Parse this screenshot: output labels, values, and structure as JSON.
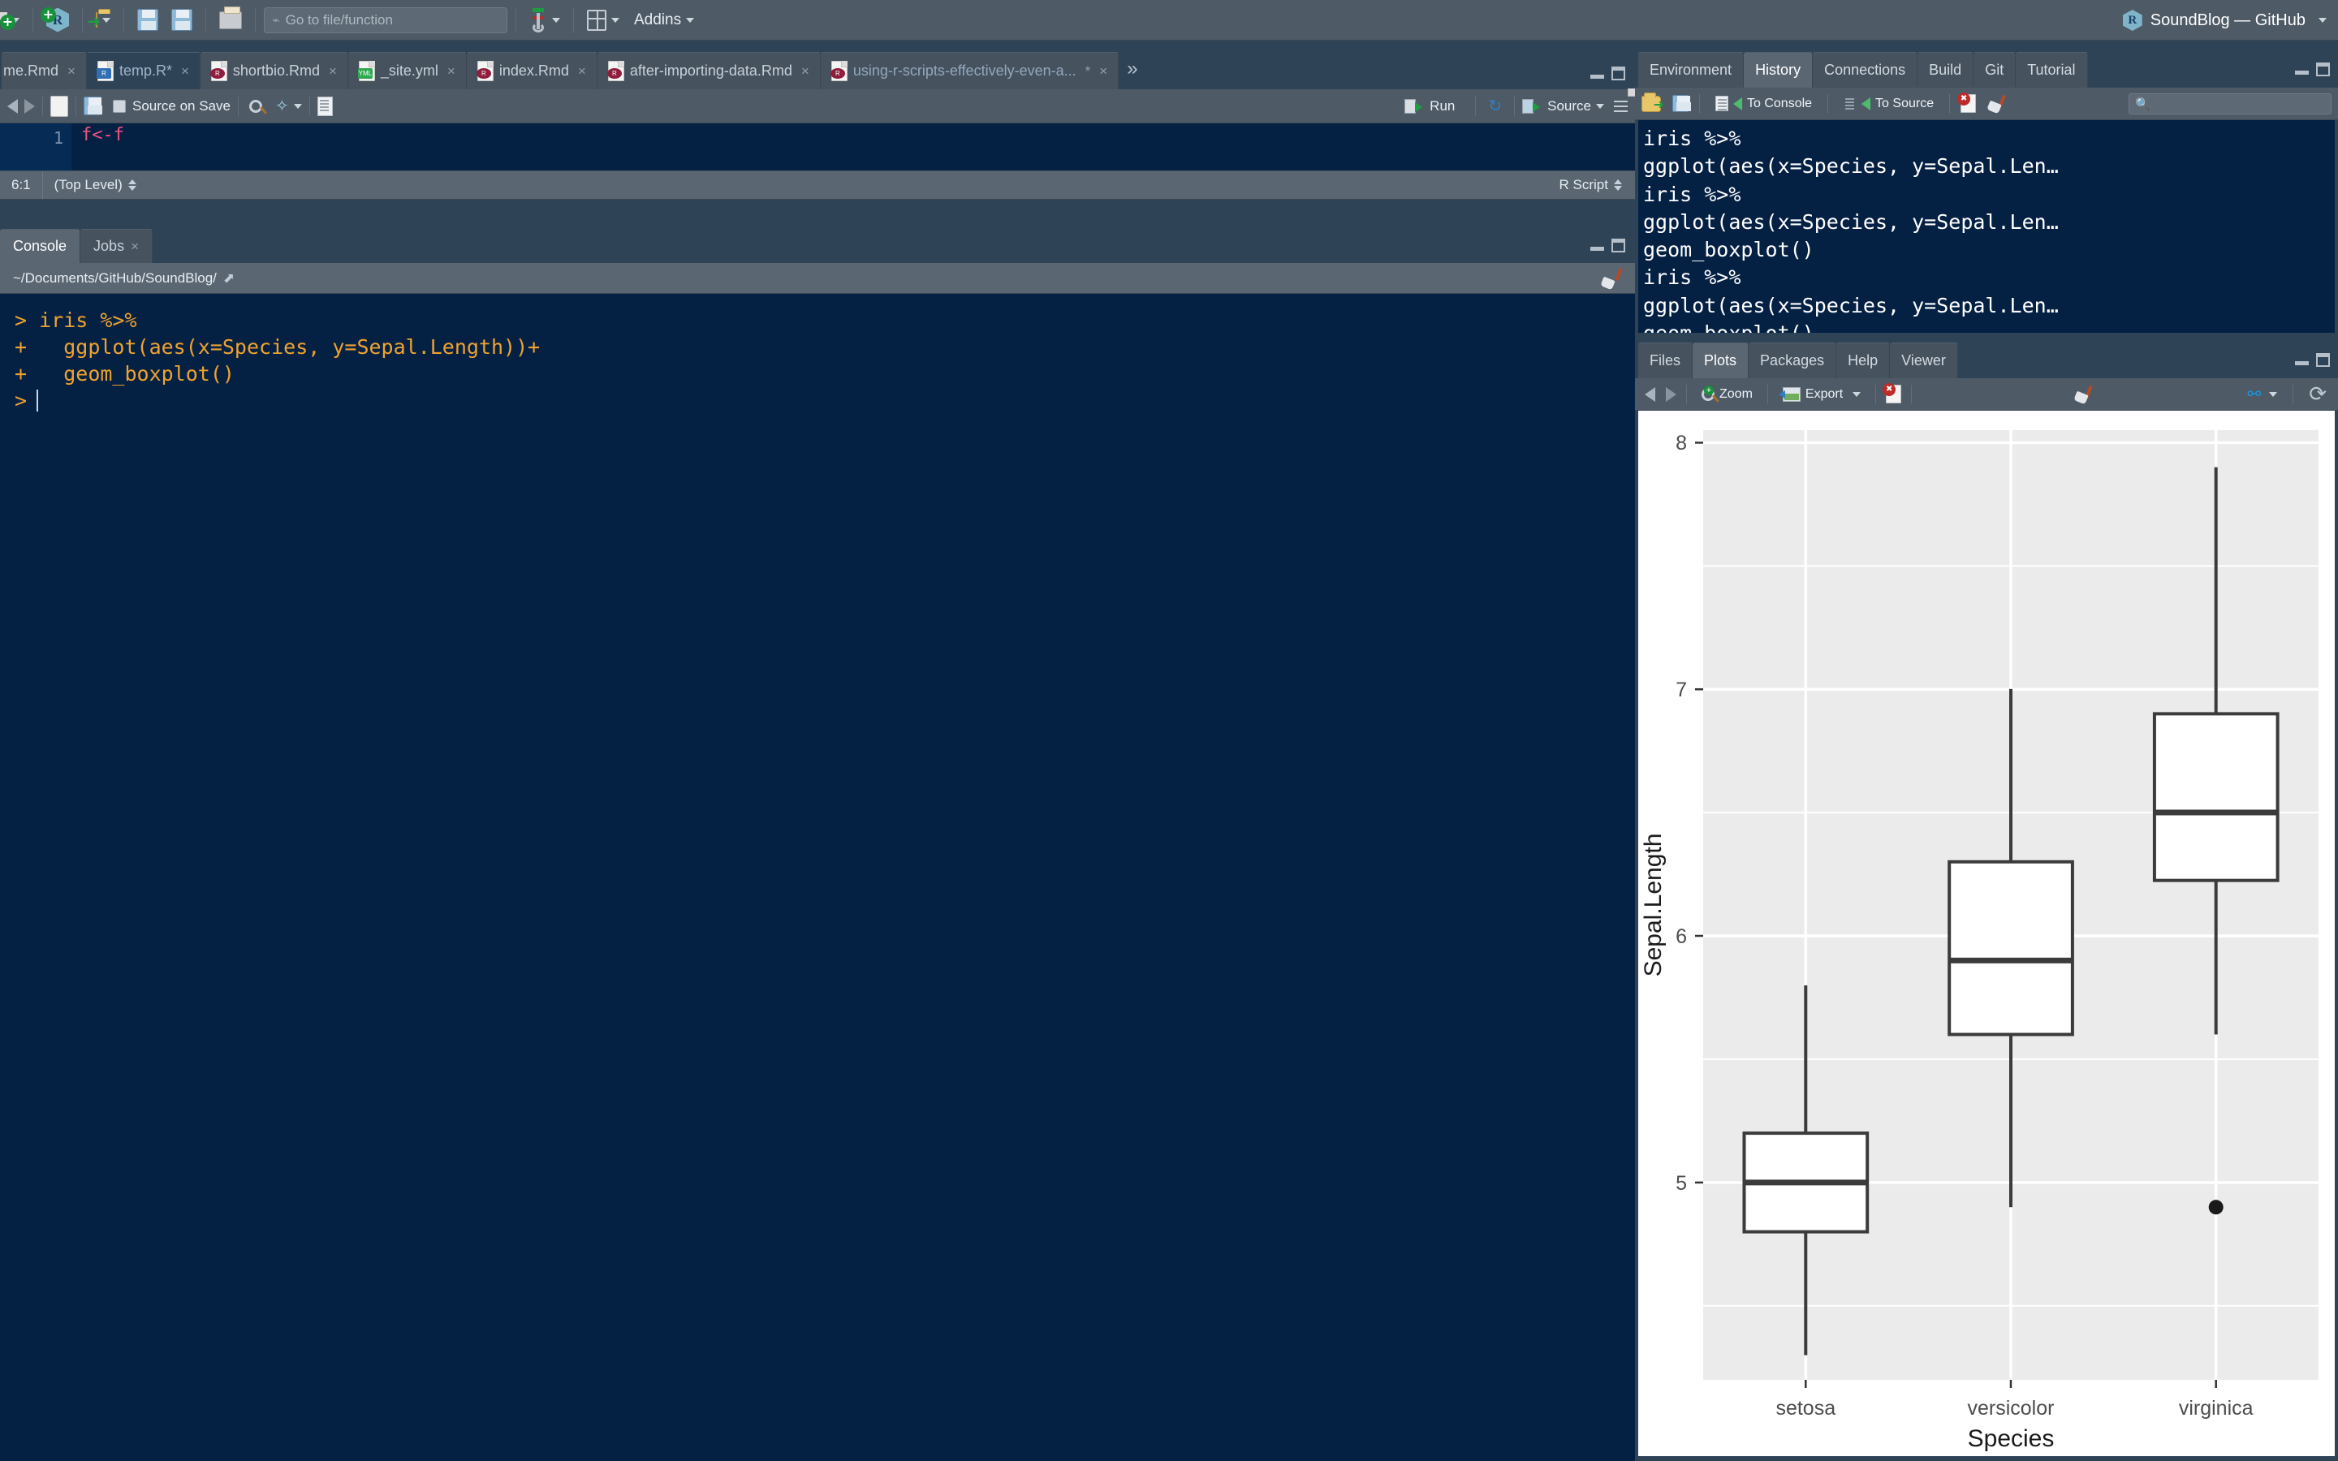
{
  "window": {
    "title": "SoundBlog — GitHub",
    "project_icon": "r-project-cube-icon",
    "title_caret": "▾"
  },
  "main_toolbar": {
    "new_file_label": "new-file",
    "new_project_label": "new-project",
    "open_file_label": "open-file",
    "save_label": "save",
    "save_all_label": "save-all",
    "print_label": "print",
    "goto_placeholder": "Go to file/function",
    "goto_value": "",
    "compile_label": "compile-report",
    "workspace_panes_label": "workspace-panes",
    "addins_label": "Addins"
  },
  "source": {
    "tabs": [
      {
        "label": "me.Rmd",
        "icon": "rmd-file-icon",
        "active": false,
        "modified": false,
        "closable": true
      },
      {
        "label": "temp.R*",
        "icon": "r-file-icon",
        "active": true,
        "modified": true,
        "closable": true
      },
      {
        "label": "shortbio.Rmd",
        "icon": "rmd-file-icon",
        "active": false,
        "modified": false,
        "closable": true
      },
      {
        "label": "_site.yml",
        "icon": "yml-file-icon",
        "active": false,
        "modified": false,
        "closable": true
      },
      {
        "label": "index.Rmd",
        "icon": "rmd-file-icon",
        "active": false,
        "modified": false,
        "closable": true
      },
      {
        "label": "after-importing-data.Rmd",
        "icon": "rmd-file-icon",
        "active": false,
        "modified": false,
        "closable": true
      },
      {
        "label": "using-r-scripts-effectively-even-a...",
        "icon": "rmd-file-icon",
        "active": false,
        "modified": true,
        "closable": true
      }
    ],
    "overflow_label": "»",
    "toolbar": {
      "back_label": "back",
      "forward_label": "forward",
      "popout_label": "show-in-new-window",
      "save_label": "save",
      "source_on_save_label": "Source on Save",
      "source_on_save_checked": false,
      "find_label": "find-replace",
      "magic_label": "code-tools",
      "compile_notebook_label": "compile-notebook",
      "run_label": "Run",
      "rerun_label": "re-run-previous",
      "source_label": "Source",
      "outline_label": "document-outline"
    },
    "line_numbers": [
      "1"
    ],
    "line1_text": "f<-f",
    "status": {
      "cursor_position": "6:1",
      "scope": "(Top Level)",
      "file_type": "R Script"
    }
  },
  "console": {
    "tabs": [
      {
        "label": "Console",
        "active": true,
        "closable": false
      },
      {
        "label": "Jobs",
        "active": false,
        "closable": true
      }
    ],
    "working_directory": "~/Documents/GitHub/SoundBlog/",
    "popout_label": "open-in-new-window",
    "clear_label": "clear-console",
    "lines": [
      {
        "prefix": ">",
        "text": " iris %>%"
      },
      {
        "prefix": "+",
        "text": "   ggplot(aes(x=Species, y=Sepal.Length))+"
      },
      {
        "prefix": "+",
        "text": "   geom_boxplot()"
      },
      {
        "prefix": ">",
        "text": ""
      }
    ]
  },
  "environment_pane": {
    "tabs": [
      {
        "label": "Environment",
        "active": false
      },
      {
        "label": "History",
        "active": true
      },
      {
        "label": "Connections",
        "active": false
      },
      {
        "label": "Build",
        "active": false
      },
      {
        "label": "Git",
        "active": false
      },
      {
        "label": "Tutorial",
        "active": false
      }
    ],
    "toolbar": {
      "load_label": "load-history",
      "save_label": "save-history",
      "to_console_label": "To Console",
      "to_source_label": "To Source",
      "remove_label": "remove-entry",
      "clear_label": "clear-history",
      "search_placeholder": "",
      "search_value": ""
    },
    "history_items": [
      "iris %>%",
      "ggplot(aes(x=Species, y=Sepal.Len…",
      "iris %>%",
      "ggplot(aes(x=Species, y=Sepal.Len…",
      "geom_boxplot()",
      "iris %>%",
      "ggplot(aes(x=Species, y=Sepal.Len…",
      "geom_boxplot()"
    ]
  },
  "plots_pane": {
    "tabs": [
      {
        "label": "Files",
        "active": false
      },
      {
        "label": "Plots",
        "active": true
      },
      {
        "label": "Packages",
        "active": false
      },
      {
        "label": "Help",
        "active": false
      },
      {
        "label": "Viewer",
        "active": false
      }
    ],
    "toolbar": {
      "prev_label": "previous-plot",
      "next_label": "next-plot",
      "zoom_label": "Zoom",
      "export_label": "Export",
      "export_caret": "▾",
      "remove_label": "remove-plot",
      "clear_label": "clear-all-plots",
      "publish_label": "publish",
      "publish_caret": "▾",
      "refresh_label": "refresh-plot"
    }
  },
  "chart_data": {
    "type": "box",
    "title": "",
    "xlabel": "Species",
    "ylabel": "Sepal.Length",
    "categories": [
      "setosa",
      "versicolor",
      "virginica"
    ],
    "ytick_labels": [
      "5",
      "6",
      "7",
      "8"
    ],
    "yticks": [
      5,
      6,
      7,
      8
    ],
    "minor_gridlines": [
      4.5,
      5.5,
      6.5,
      7.5
    ],
    "ylim": [
      4.2,
      8.05
    ],
    "grid": true,
    "legend": "none",
    "panel_background": "#ebebeb",
    "gridline_color": "#ffffff",
    "box_fill": "#ffffff",
    "box_stroke": "#3b3b3b",
    "boxes": [
      {
        "category": "setosa",
        "lower_whisker": 4.3,
        "q1": 4.8,
        "median": 5.0,
        "q3": 5.2,
        "upper_whisker": 5.8,
        "outliers": []
      },
      {
        "category": "versicolor",
        "lower_whisker": 4.9,
        "q1": 5.6,
        "median": 5.9,
        "q3": 6.3,
        "upper_whisker": 7.0,
        "outliers": []
      },
      {
        "category": "virginica",
        "lower_whisker": 5.6,
        "q1": 6.225,
        "median": 6.5,
        "q3": 6.9,
        "upper_whisker": 7.9,
        "outliers": [
          4.9
        ]
      }
    ]
  }
}
